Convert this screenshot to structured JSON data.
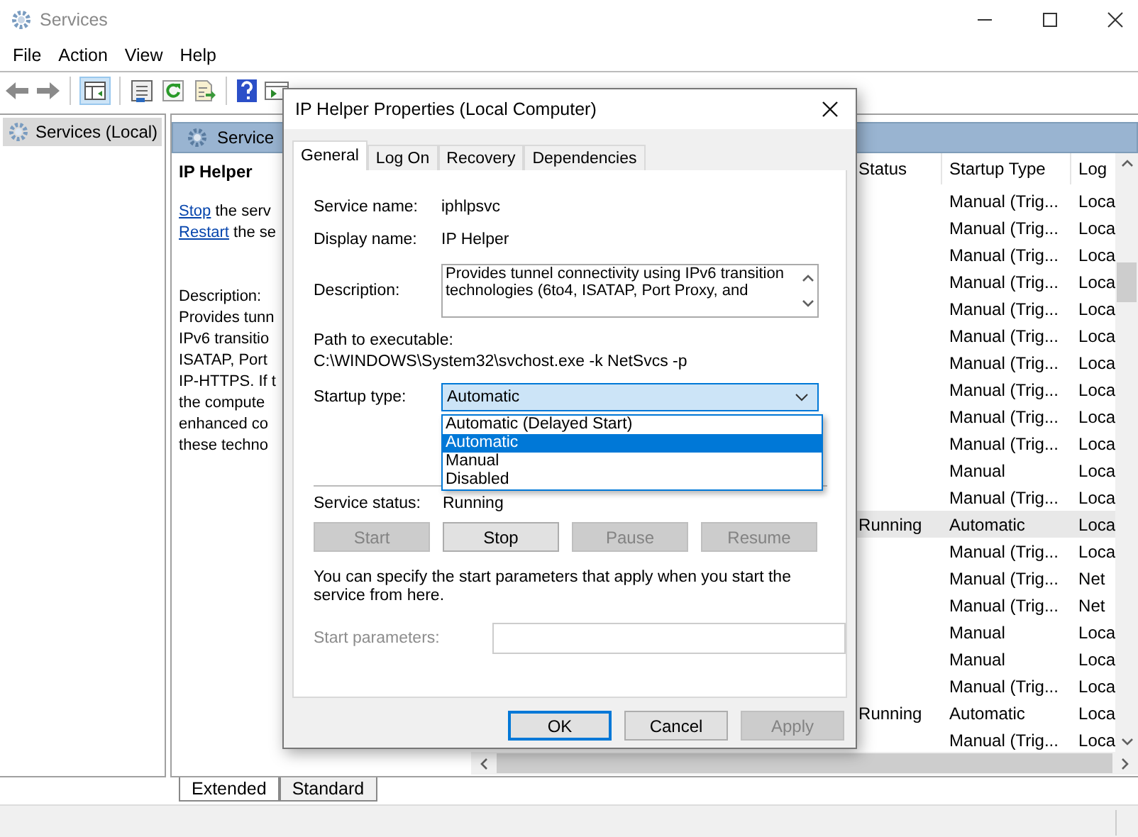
{
  "window": {
    "title": "Services",
    "menu": [
      "File",
      "Action",
      "View",
      "Help"
    ]
  },
  "tree": {
    "items": [
      {
        "label": "Services (Local)",
        "selected": true
      }
    ]
  },
  "pane_header": "Service",
  "details": {
    "name": "IP Helper",
    "actions": [
      {
        "link": "Stop",
        "rest": "the serv"
      },
      {
        "link": "Restart",
        "rest": "the se"
      }
    ],
    "description_lines": [
      "Description:",
      "Provides tunn",
      "IPv6 transitio",
      "ISATAP, Port",
      "IP-HTTPS. If t",
      "the compute",
      "enhanced co",
      "these techno"
    ]
  },
  "table": {
    "columns": [
      "Status",
      "Startup Type",
      "Log"
    ],
    "rows": [
      {
        "startup": "Manual (Trig...",
        "log": "Loca",
        "selected": false
      },
      {
        "startup": "Manual (Trig...",
        "log": "Loca",
        "selected": false
      },
      {
        "startup": "Manual (Trig...",
        "log": "Loca",
        "selected": false
      },
      {
        "startup": "Manual (Trig...",
        "log": "Loca",
        "selected": false
      },
      {
        "startup": "Manual (Trig...",
        "log": "Loca",
        "selected": false
      },
      {
        "startup": "Manual (Trig...",
        "log": "Loca",
        "selected": false
      },
      {
        "startup": "Manual (Trig...",
        "log": "Loca",
        "selected": false
      },
      {
        "startup": "Manual (Trig...",
        "log": "Loca",
        "selected": false
      },
      {
        "startup": "Manual (Trig...",
        "log": "Loca",
        "selected": false
      },
      {
        "startup": "Manual (Trig...",
        "log": "Loca",
        "selected": false
      },
      {
        "startup": "Manual",
        "log": "Loca",
        "selected": false
      },
      {
        "startup": "Manual (Trig...",
        "log": "Loca",
        "selected": false
      },
      {
        "status": "Running",
        "startup": "Automatic",
        "log": "Loca",
        "selected": true
      },
      {
        "startup": "Manual (Trig...",
        "log": "Loca",
        "selected": false
      },
      {
        "startup": "Manual (Trig...",
        "log": "Net",
        "selected": false
      },
      {
        "startup": "Manual (Trig...",
        "log": "Net",
        "selected": false
      },
      {
        "startup": "Manual",
        "log": "Loca",
        "selected": false
      },
      {
        "startup": "Manual",
        "log": "Loca",
        "selected": false
      },
      {
        "startup": "Manual (Trig...",
        "log": "Loca",
        "selected": false
      },
      {
        "status": "Running",
        "startup": "Automatic",
        "log": "Loca",
        "selected": false
      },
      {
        "startup": "Manual (Trig...",
        "log": "Loca",
        "selected": false
      }
    ]
  },
  "view_tabs": [
    {
      "label": "Extended",
      "selected": true
    },
    {
      "label": "Standard",
      "selected": false
    }
  ],
  "dialog": {
    "title": "IP Helper Properties (Local Computer)",
    "tabs": [
      {
        "label": "General",
        "selected": true
      },
      {
        "label": "Log On",
        "selected": false
      },
      {
        "label": "Recovery",
        "selected": false
      },
      {
        "label": "Dependencies",
        "selected": false
      }
    ],
    "service_name": {
      "label": "Service name:",
      "value": "iphlpsvc"
    },
    "display_name": {
      "label": "Display name:",
      "value": "IP Helper"
    },
    "description": {
      "label": "Description:",
      "value": "Provides tunnel connectivity using IPv6 transition technologies (6to4, ISATAP, Port Proxy, and"
    },
    "path": {
      "label": "Path to executable:",
      "value": "C:\\WINDOWS\\System32\\svchost.exe -k NetSvcs -p"
    },
    "startup_type": {
      "label": "Startup type:",
      "value": "Automatic",
      "expanded": true,
      "options": [
        {
          "label": "Automatic (Delayed Start)",
          "selected": false
        },
        {
          "label": "Automatic",
          "selected": true
        },
        {
          "label": "Manual",
          "selected": false
        },
        {
          "label": "Disabled",
          "selected": false
        }
      ]
    },
    "service_status": {
      "label": "Service status:",
      "value": "Running"
    },
    "control_buttons": [
      {
        "label": "Start",
        "disabled": true
      },
      {
        "label": "Stop",
        "disabled": false
      },
      {
        "label": "Pause",
        "disabled": true
      },
      {
        "label": "Resume",
        "disabled": true
      }
    ],
    "hint": "You can specify the start parameters that apply when you start the service from here.",
    "start_parameters": {
      "label": "Start parameters:",
      "disabled": true
    },
    "buttons": [
      {
        "label": "OK",
        "default": true,
        "disabled": false
      },
      {
        "label": "Cancel",
        "default": false,
        "disabled": false
      },
      {
        "label": "Apply",
        "default": false,
        "disabled": true
      }
    ]
  }
}
